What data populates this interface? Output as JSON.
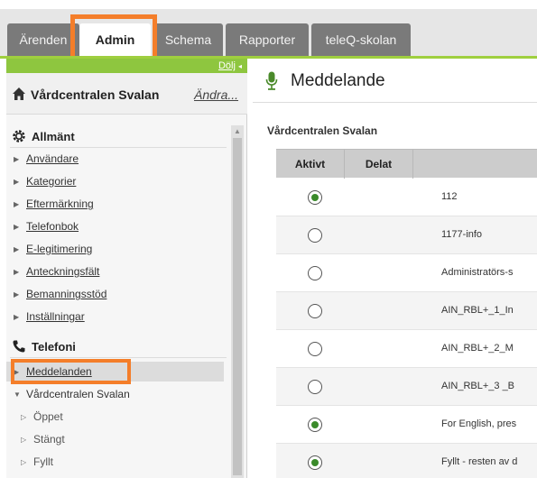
{
  "tabs": [
    {
      "label": "Ärenden",
      "active": false
    },
    {
      "label": "Admin",
      "active": true
    },
    {
      "label": "Schema",
      "active": false
    },
    {
      "label": "Rapporter",
      "active": false
    },
    {
      "label": "teleQ-skolan",
      "active": false
    }
  ],
  "sidebar": {
    "hide_label": "Dölj",
    "org_name": "Vårdcentralen Svalan",
    "change_label": "Ändra...",
    "general": {
      "title": "Allmänt",
      "items": [
        "Användare",
        "Kategorier",
        "Eftermärkning",
        "Telefonbok",
        "E-legitimering",
        "Anteckningsfält",
        "Bemanningsstöd",
        "Inställningar"
      ]
    },
    "telephony": {
      "title": "Telefoni",
      "selected_item": "Meddelanden",
      "expanded_item": "Vårdcentralen Svalan",
      "sub_items": [
        "Öppet",
        "Stängt",
        "Fyllt"
      ]
    }
  },
  "main": {
    "title": "Meddelande",
    "org_label": "Vårdcentralen Svalan",
    "columns": [
      "Aktivt",
      "Delat",
      ""
    ],
    "rows": [
      {
        "active": true,
        "name": "112"
      },
      {
        "active": false,
        "name": "1177-info"
      },
      {
        "active": false,
        "name": "Administratörs-s"
      },
      {
        "active": false,
        "name": "AIN_RBL+_1_In"
      },
      {
        "active": false,
        "name": "AIN_RBL+_2_M"
      },
      {
        "active": false,
        "name": "AIN_RBL+_3 _B"
      },
      {
        "active": true,
        "name": "For English, pres"
      },
      {
        "active": true,
        "name": "Fyllt - resten av d"
      }
    ]
  },
  "colors": {
    "accent_green": "#8ec63f",
    "highlight_orange": "#f47e2a",
    "tab_gray": "#7a7a7a",
    "radio_green": "#3a8a2a"
  },
  "icons": [
    "home-icon",
    "gear-icon",
    "phone-icon",
    "microphone-icon"
  ]
}
